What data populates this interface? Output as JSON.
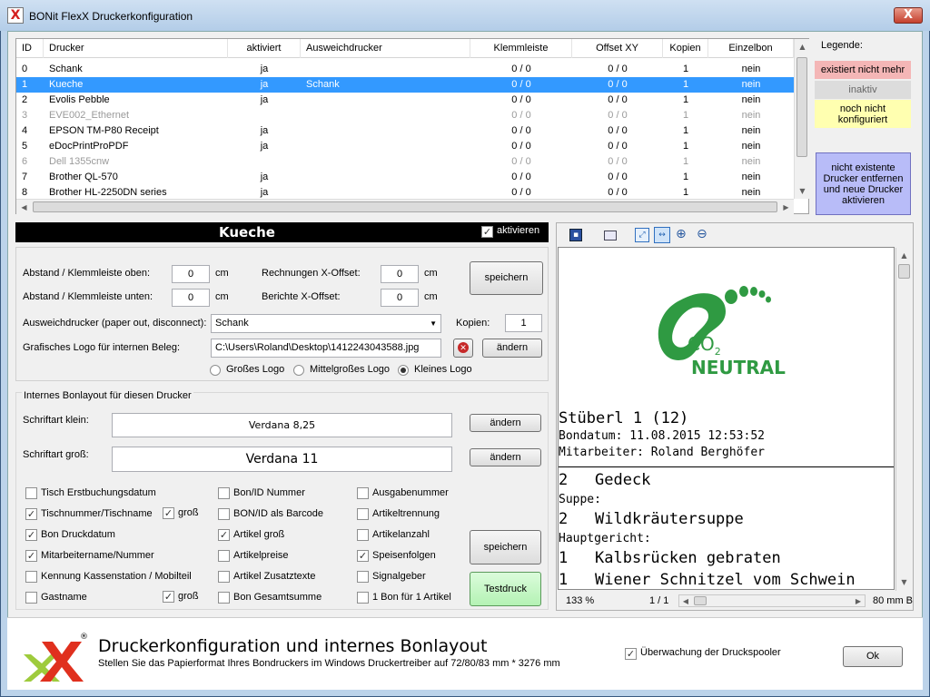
{
  "window": {
    "title": "BONit FlexX Druckerkonfiguration",
    "close": "X"
  },
  "grid": {
    "columns": [
      "ID",
      "Drucker",
      "aktiviert",
      "Ausweichdrucker",
      "Klemmleiste",
      "Offset XY",
      "Kopien",
      "Einzelbon"
    ],
    "rows": [
      {
        "id": "0",
        "name": "Schank",
        "active": "ja",
        "fallback": "",
        "klemm": "0 / 0",
        "offset": "0 / 0",
        "copies": "1",
        "single": "nein",
        "state": "normal"
      },
      {
        "id": "1",
        "name": "Kueche",
        "active": "ja",
        "fallback": "Schank",
        "klemm": "0 / 0",
        "offset": "0 / 0",
        "copies": "1",
        "single": "nein",
        "state": "selected"
      },
      {
        "id": "2",
        "name": "Evolis Pebble",
        "active": "ja",
        "fallback": "",
        "klemm": "0 / 0",
        "offset": "0 / 0",
        "copies": "1",
        "single": "nein",
        "state": "normal"
      },
      {
        "id": "3",
        "name": "EVE002_Ethernet",
        "active": "",
        "fallback": "",
        "klemm": "0 / 0",
        "offset": "0 / 0",
        "copies": "1",
        "single": "nein",
        "state": "inactive"
      },
      {
        "id": "4",
        "name": "EPSON TM-P80 Receipt",
        "active": "ja",
        "fallback": "",
        "klemm": "0 / 0",
        "offset": "0 / 0",
        "copies": "1",
        "single": "nein",
        "state": "normal"
      },
      {
        "id": "5",
        "name": "eDocPrintProPDF",
        "active": "ja",
        "fallback": "",
        "klemm": "0 / 0",
        "offset": "0 / 0",
        "copies": "1",
        "single": "nein",
        "state": "normal"
      },
      {
        "id": "6",
        "name": "Dell 1355cnw",
        "active": "",
        "fallback": "",
        "klemm": "0 / 0",
        "offset": "0 / 0",
        "copies": "1",
        "single": "nein",
        "state": "inactive"
      },
      {
        "id": "7",
        "name": "Brother QL-570",
        "active": "ja",
        "fallback": "",
        "klemm": "0 / 0",
        "offset": "0 / 0",
        "copies": "1",
        "single": "nein",
        "state": "normal"
      },
      {
        "id": "8",
        "name": "Brother HL-2250DN series",
        "active": "ja",
        "fallback": "",
        "klemm": "0 / 0",
        "offset": "0 / 0",
        "copies": "1",
        "single": "nein",
        "state": "normal"
      }
    ]
  },
  "legend": {
    "title": "Legende:",
    "missing": "existiert nicht mehr",
    "inactive": "inaktiv",
    "unconfigured": "noch nicht konfiguriert",
    "missing_color": "#f4b6b6",
    "inactive_color": "#dcdcdc",
    "unconfigured_color": "#ffffb0"
  },
  "remove_button": "nicht existente Drucker entfernen und neue Drucker aktivieren",
  "printer": {
    "name": "Kueche",
    "activate_label": "aktivieren",
    "abstand_oben_label": "Abstand / Klemmleiste oben:",
    "abstand_oben": "0",
    "abstand_unten_label": "Abstand / Klemmleiste unten:",
    "abstand_unten": "0",
    "unit": "cm",
    "rechnungen_label": "Rechnungen X-Offset:",
    "rechnungen": "0",
    "berichte_label": "Berichte X-Offset:",
    "berichte": "0",
    "save": "speichern",
    "fallback_label": "Ausweichdrucker (paper out, disconnect):",
    "fallback": "Schank",
    "copies_label": "Kopien:",
    "copies": "1",
    "logo_label": "Grafisches Logo für internen Beleg:",
    "logo_path": "C:\\Users\\Roland\\Desktop\\1412243043588.jpg",
    "change": "ändern",
    "logo_sizes": [
      "Großes Logo",
      "Mittelgroßes Logo",
      "Kleines Logo"
    ]
  },
  "layout": {
    "group_title": "Internes Bonlayout für diesen Drucker",
    "font_small_label": "Schriftart klein:",
    "font_small": "Verdana 8,25",
    "font_large_label": "Schriftart groß:",
    "font_large": "Verdana 11",
    "change": "ändern",
    "options_col1": [
      {
        "label": "Tisch Erstbuchungsdatum",
        "checked": false
      },
      {
        "label": "Tischnummer/Tischname",
        "checked": true
      },
      {
        "label": "Bon Druckdatum",
        "checked": true
      },
      {
        "label": "Mitarbeitername/Nummer",
        "checked": true
      },
      {
        "label": "Kennung Kassenstation / Mobilteil",
        "checked": false
      },
      {
        "label": "Gastname",
        "checked": false
      }
    ],
    "gross_label": "groß",
    "options_col2": [
      {
        "label": "Bon/ID Nummer",
        "checked": false
      },
      {
        "label": "BON/ID als Barcode",
        "checked": false
      },
      {
        "label": "Artikel groß",
        "checked": true
      },
      {
        "label": "Artikelpreise",
        "checked": false
      },
      {
        "label": "Artikel Zusatztexte",
        "checked": false
      },
      {
        "label": "Bon Gesamtsumme",
        "checked": false
      }
    ],
    "options_col3": [
      {
        "label": "Ausgabenummer",
        "checked": false
      },
      {
        "label": "Artikeltrennung",
        "checked": false
      },
      {
        "label": "Artikelanzahl",
        "checked": false
      },
      {
        "label": "Speisenfolgen",
        "checked": true
      },
      {
        "label": "Signalgeber",
        "checked": false
      },
      {
        "label": "1 Bon für 1 Artikel",
        "checked": false
      }
    ],
    "save": "speichern",
    "test": "Testdruck"
  },
  "preview": {
    "co2": "CO",
    "co2_sub": "2",
    "neutral": "NEUTRAL",
    "table": "Stüberl 1 (12)",
    "bondatum": "Bondatum: 11.08.2015 12:53:52",
    "mitarbeiter": "Mitarbeiter: Roland Berghöfer",
    "lines": [
      {
        "qty": "2",
        "text": "Gedeck",
        "big": true
      },
      {
        "qty": "",
        "text": "Suppe:",
        "big": false
      },
      {
        "qty": "2",
        "text": "Wildkräutersuppe",
        "big": true
      },
      {
        "qty": "",
        "text": "Hauptgericht:",
        "big": false
      },
      {
        "qty": "1",
        "text": "Kalbsrücken gebraten",
        "big": true
      },
      {
        "qty": "1",
        "text": "Wiener Schnitzel vom Schwein",
        "big": true
      }
    ],
    "zoom": "133 %",
    "page": "1 / 1",
    "paper": "80 mm B"
  },
  "footer": {
    "title": "Druckerkonfiguration und internes Bonlayout",
    "subtitle": "Stellen Sie das Papierformat Ihres Bondruckers im Windows Druckertreiber auf 72/80/83 mm * 3276 mm",
    "spooler_label": "Überwachung der Druckspooler",
    "ok": "Ok"
  }
}
